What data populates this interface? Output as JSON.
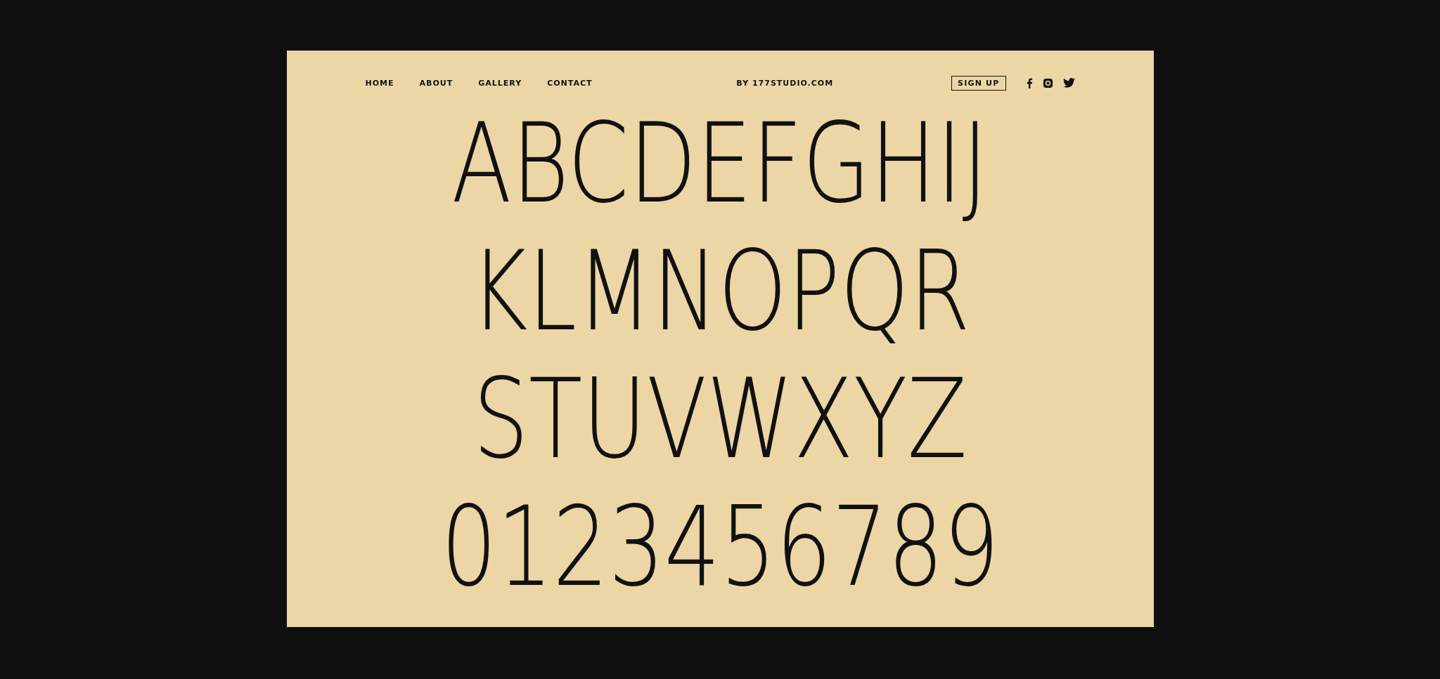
{
  "nav": {
    "links": [
      "HOME",
      "ABOUT",
      "GALLERY",
      "CONTACT"
    ],
    "credit": "BY 177STUDIO.COM",
    "signup": "SIGN UP"
  },
  "specimen_rows": [
    "ABCDEFGHIJ",
    "KLMNOPQR",
    "STUVWXYZ",
    "0123456789"
  ]
}
